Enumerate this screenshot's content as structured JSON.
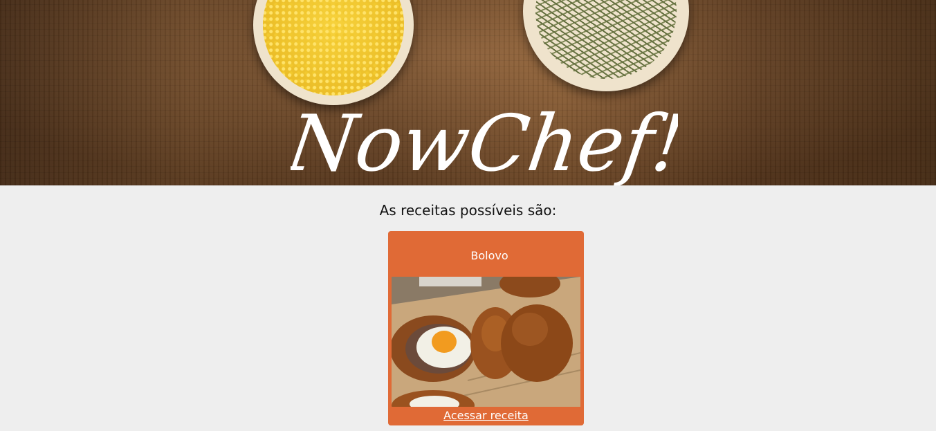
{
  "header": {
    "logo_text": "NowChef!"
  },
  "main": {
    "heading": "As receitas possíveis são:",
    "recipes": [
      {
        "title": "Bolovo",
        "link_label": "Acessar receita"
      }
    ]
  },
  "colors": {
    "page_background": "#eeeeee",
    "card_background": "#e06a36",
    "card_text": "#ffffff"
  }
}
